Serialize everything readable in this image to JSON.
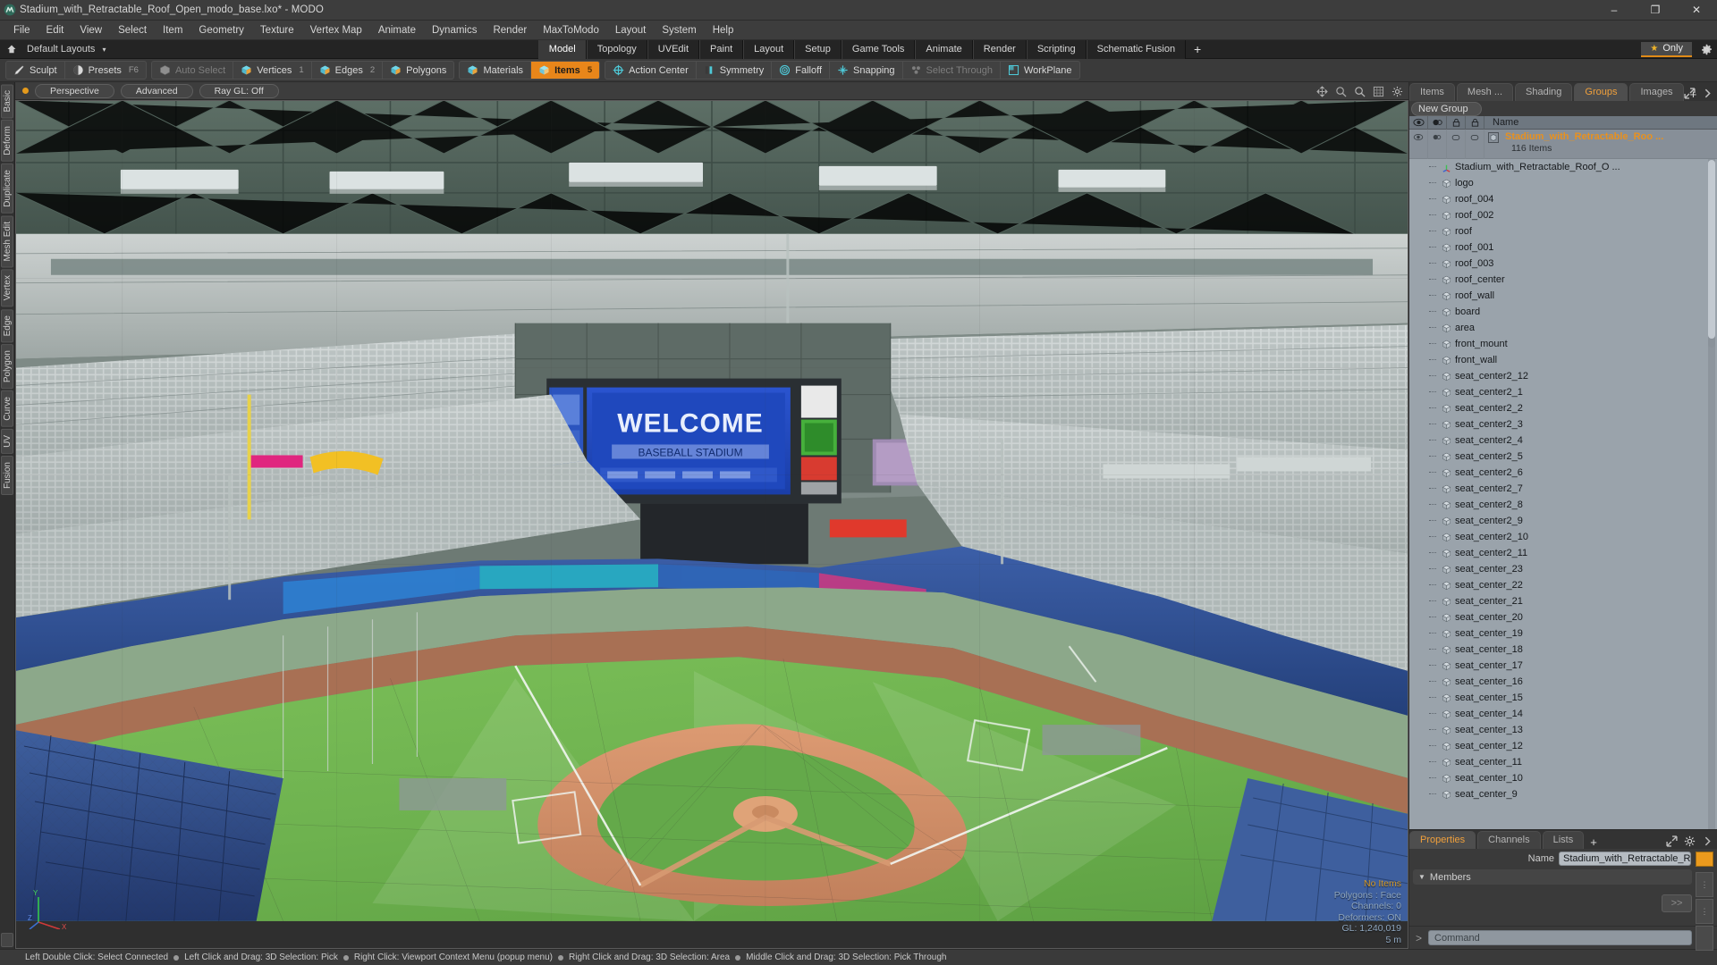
{
  "window": {
    "title": "Stadium_with_Retractable_Roof_Open_modo_base.lxo* - MODO",
    "app_icon": "modo-logo-icon",
    "minimize": "–",
    "maximize": "❐",
    "close": "✕"
  },
  "menubar": [
    "File",
    "Edit",
    "View",
    "Select",
    "Item",
    "Geometry",
    "Texture",
    "Vertex Map",
    "Animate",
    "Dynamics",
    "Render",
    "MaxToModo",
    "Layout",
    "System",
    "Help"
  ],
  "layoutrow": {
    "home_icon": "home-icon",
    "label": "Default Layouts",
    "caret": "▾",
    "tabs": [
      {
        "label": "Model",
        "active": true
      },
      {
        "label": "Topology",
        "active": false
      },
      {
        "label": "UVEdit",
        "active": false
      },
      {
        "label": "Paint",
        "active": false
      },
      {
        "label": "Layout",
        "active": false
      },
      {
        "label": "Setup",
        "active": false
      },
      {
        "label": "Game Tools",
        "active": false
      },
      {
        "label": "Animate",
        "active": false
      },
      {
        "label": "Render",
        "active": false
      },
      {
        "label": "Scripting",
        "active": false
      },
      {
        "label": "Schematic Fusion",
        "active": false
      }
    ],
    "plus": "+",
    "only_label": "Only",
    "only_star": "★",
    "gear_icon": "gear-icon"
  },
  "modebar": {
    "group1": [
      {
        "label": "Sculpt",
        "icon": "sculpt-brush-icon",
        "num": "",
        "state": "normal"
      },
      {
        "label": "Presets",
        "icon": "presets-sphere-icon",
        "num": "F6",
        "state": "normal"
      }
    ],
    "group2": [
      {
        "label": "Auto Select",
        "icon": "cube-grey-icon",
        "num": "",
        "state": "dim"
      },
      {
        "label": "Vertices",
        "icon": "cube-vertices-icon",
        "num": "1",
        "state": "normal"
      },
      {
        "label": "Edges",
        "icon": "cube-edges-icon",
        "num": "2",
        "state": "normal"
      },
      {
        "label": "Polygons",
        "icon": "cube-polygons-icon",
        "num": "",
        "state": "normal"
      }
    ],
    "group3": [
      {
        "label": "Materials",
        "icon": "cube-materials-icon",
        "num": "",
        "state": "normal"
      },
      {
        "label": "Items",
        "icon": "cube-items-icon",
        "num": "5",
        "state": "active"
      }
    ],
    "group4": [
      {
        "label": "Action Center",
        "icon": "action-center-icon",
        "num": "",
        "state": "normal"
      },
      {
        "label": "Symmetry",
        "icon": "symmetry-icon",
        "num": "",
        "state": "normal"
      },
      {
        "label": "Falloff",
        "icon": "falloff-icon",
        "num": "",
        "state": "normal"
      },
      {
        "label": "Snapping",
        "icon": "snapping-icon",
        "num": "",
        "state": "normal"
      },
      {
        "label": "Select Through",
        "icon": "select-through-icon",
        "num": "",
        "state": "dim"
      },
      {
        "label": "WorkPlane",
        "icon": "workplane-icon",
        "num": "",
        "state": "normal"
      }
    ]
  },
  "vtabs": [
    "Basic",
    "Deform",
    "Duplicate",
    "Mesh Edit",
    "Vertex",
    "Edge",
    "Polygon",
    "Curve",
    "UV",
    "Fusion"
  ],
  "viewport": {
    "dot": "active-dot",
    "pills": [
      "Perspective",
      "Advanced",
      "Ray GL: Off"
    ],
    "header_icons": [
      "move-view-icon",
      "zoom-view-icon",
      "search-icon",
      "grid-icon",
      "gear-icon"
    ],
    "stats": {
      "selection": "No Items",
      "polygons": "Polygons : Face",
      "channels": "Channels: 0",
      "deformers": "Deformers: ON",
      "gl": "GL: 1,240,019",
      "scale": "5 m"
    },
    "axis": {
      "x": "X",
      "y": "Y",
      "z": "Z"
    }
  },
  "rightpanel": {
    "tabs": [
      {
        "label": "Items",
        "active": false
      },
      {
        "label": "Mesh ...",
        "active": false
      },
      {
        "label": "Shading",
        "active": false
      },
      {
        "label": "Groups",
        "active": true
      },
      {
        "label": "Images",
        "active": false
      }
    ],
    "tab_plus": "+",
    "tab_right_icons": [
      "expand-icon",
      "chevron-right-icon"
    ],
    "new_group_button": "New Group",
    "list_columns": [
      "eye-icon",
      "render-icon",
      "lock-icon",
      "select-icon"
    ],
    "name_column": "Name",
    "group": {
      "name": "Stadium_with_Retractable_Roo ...",
      "count": "116 Items",
      "icon": "group-cube-icon"
    },
    "items": [
      {
        "label": "Stadium_with_Retractable_Roof_O ...",
        "icon": "locator-axis-icon"
      },
      {
        "label": "logo",
        "icon": "mesh-cube-icon"
      },
      {
        "label": "roof_004",
        "icon": "mesh-cube-icon"
      },
      {
        "label": "roof_002",
        "icon": "mesh-cube-icon"
      },
      {
        "label": "roof",
        "icon": "mesh-cube-icon"
      },
      {
        "label": "roof_001",
        "icon": "mesh-cube-icon"
      },
      {
        "label": "roof_003",
        "icon": "mesh-cube-icon"
      },
      {
        "label": "roof_center",
        "icon": "mesh-cube-icon"
      },
      {
        "label": "roof_wall",
        "icon": "mesh-cube-icon"
      },
      {
        "label": "board",
        "icon": "mesh-cube-icon"
      },
      {
        "label": "area",
        "icon": "mesh-cube-icon"
      },
      {
        "label": "front_mount",
        "icon": "mesh-cube-icon"
      },
      {
        "label": "front_wall",
        "icon": "mesh-cube-icon"
      },
      {
        "label": "seat_center2_12",
        "icon": "mesh-cube-icon"
      },
      {
        "label": "seat_center2_1",
        "icon": "mesh-cube-icon"
      },
      {
        "label": "seat_center2_2",
        "icon": "mesh-cube-icon"
      },
      {
        "label": "seat_center2_3",
        "icon": "mesh-cube-icon"
      },
      {
        "label": "seat_center2_4",
        "icon": "mesh-cube-icon"
      },
      {
        "label": "seat_center2_5",
        "icon": "mesh-cube-icon"
      },
      {
        "label": "seat_center2_6",
        "icon": "mesh-cube-icon"
      },
      {
        "label": "seat_center2_7",
        "icon": "mesh-cube-icon"
      },
      {
        "label": "seat_center2_8",
        "icon": "mesh-cube-icon"
      },
      {
        "label": "seat_center2_9",
        "icon": "mesh-cube-icon"
      },
      {
        "label": "seat_center2_10",
        "icon": "mesh-cube-icon"
      },
      {
        "label": "seat_center2_11",
        "icon": "mesh-cube-icon"
      },
      {
        "label": "seat_center_23",
        "icon": "mesh-cube-icon"
      },
      {
        "label": "seat_center_22",
        "icon": "mesh-cube-icon"
      },
      {
        "label": "seat_center_21",
        "icon": "mesh-cube-icon"
      },
      {
        "label": "seat_center_20",
        "icon": "mesh-cube-icon"
      },
      {
        "label": "seat_center_19",
        "icon": "mesh-cube-icon"
      },
      {
        "label": "seat_center_18",
        "icon": "mesh-cube-icon"
      },
      {
        "label": "seat_center_17",
        "icon": "mesh-cube-icon"
      },
      {
        "label": "seat_center_16",
        "icon": "mesh-cube-icon"
      },
      {
        "label": "seat_center_15",
        "icon": "mesh-cube-icon"
      },
      {
        "label": "seat_center_14",
        "icon": "mesh-cube-icon"
      },
      {
        "label": "seat_center_13",
        "icon": "mesh-cube-icon"
      },
      {
        "label": "seat_center_12",
        "icon": "mesh-cube-icon"
      },
      {
        "label": "seat_center_11",
        "icon": "mesh-cube-icon"
      },
      {
        "label": "seat_center_10",
        "icon": "mesh-cube-icon"
      },
      {
        "label": "seat_center_9",
        "icon": "mesh-cube-icon"
      }
    ]
  },
  "properties": {
    "tabs": [
      {
        "label": "Properties",
        "active": true
      },
      {
        "label": "Channels",
        "active": false
      },
      {
        "label": "Lists",
        "active": false
      }
    ],
    "tab_plus": "+",
    "name_label": "Name",
    "name_value": "Stadium_with_Retractable_Roof_Open",
    "members_label": "Members",
    "members_button": ">>"
  },
  "command": {
    "prompt": ">",
    "placeholder": "Command",
    "record_icon": "record-ring-icon"
  },
  "statusbar": [
    "Left Double Click: Select Connected",
    "Left Click and Drag: 3D Selection: Pick",
    "Right Click: Viewport Context Menu (popup menu)",
    "Right Click and Drag: 3D Selection: Area",
    "Middle Click and Drag: 3D Selection: Pick Through"
  ],
  "scene": {
    "jumbotron_text": "WELCOME",
    "jumbotron_sub": "BASEBALL STADIUM"
  }
}
